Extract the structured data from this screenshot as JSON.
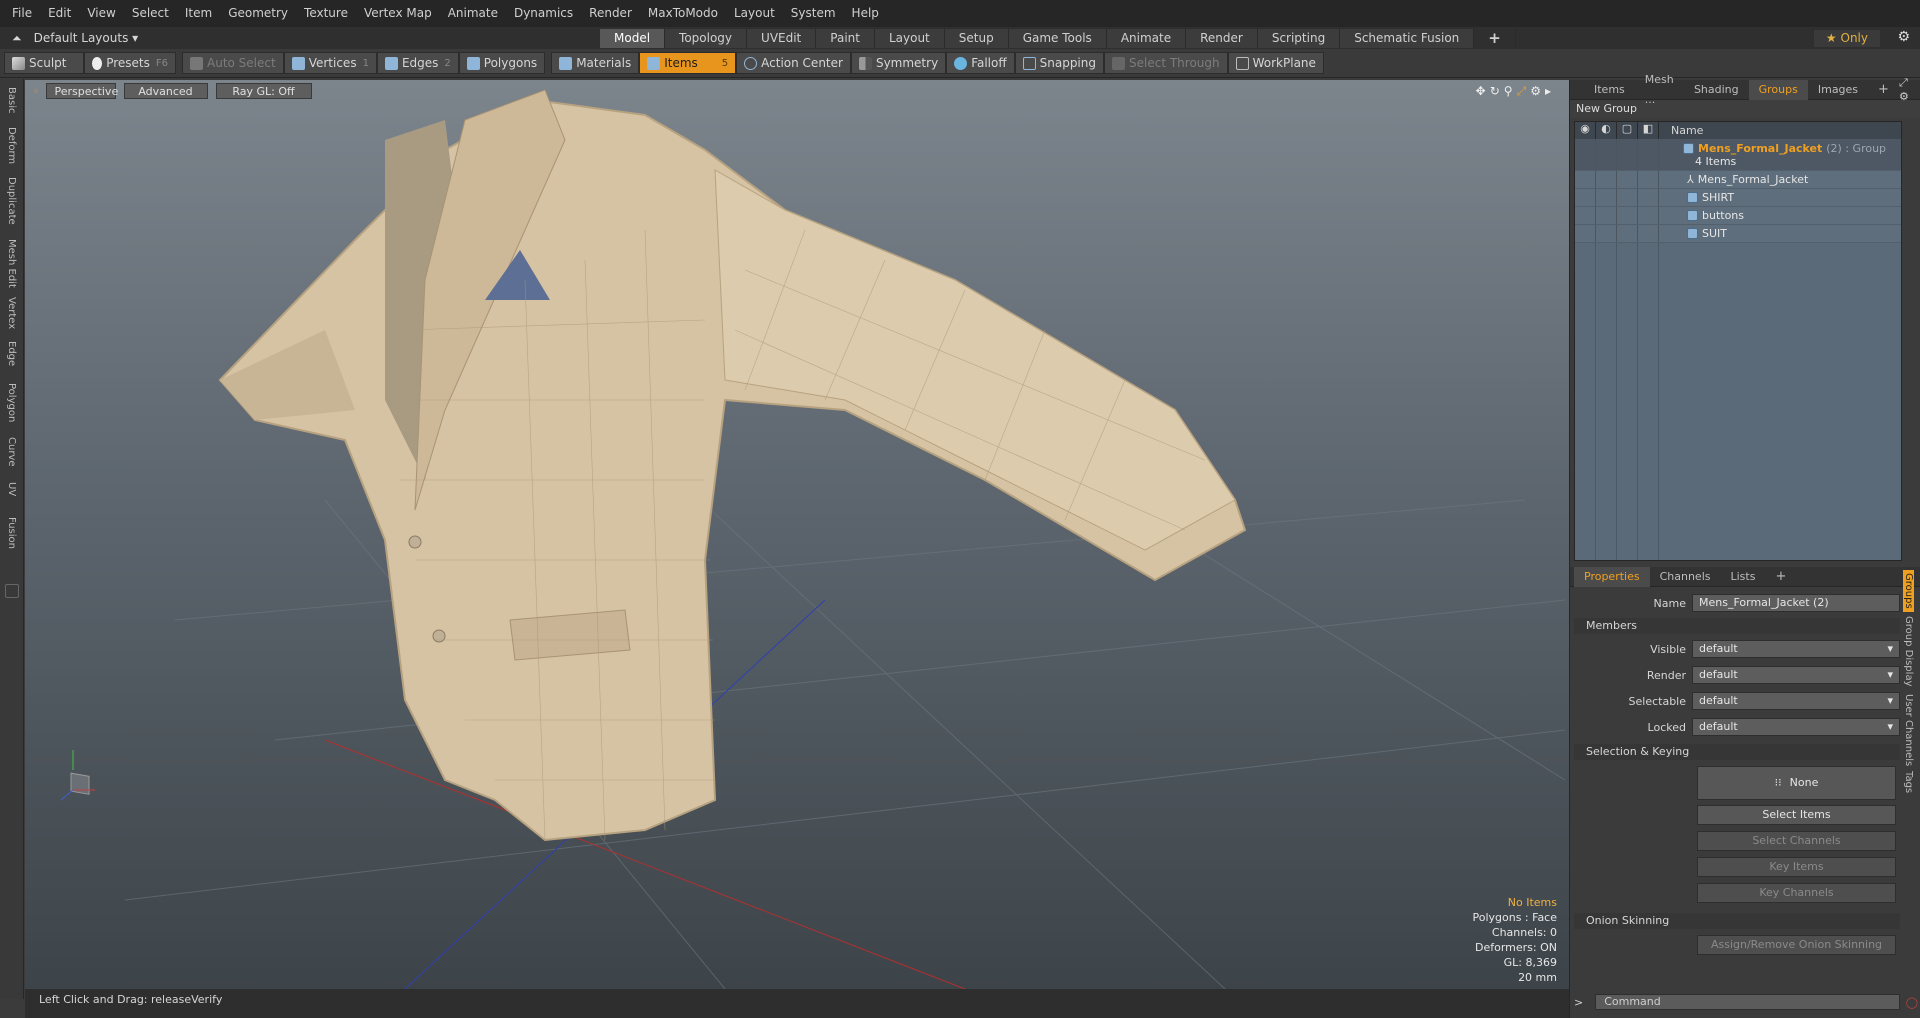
{
  "menubar": [
    "File",
    "Edit",
    "View",
    "Select",
    "Item",
    "Geometry",
    "Texture",
    "Vertex Map",
    "Animate",
    "Dynamics",
    "Render",
    "MaxToModo",
    "Layout",
    "System",
    "Help"
  ],
  "layouts_label": "Default Layouts",
  "layout_tabs": [
    "Model",
    "Topology",
    "UVEdit",
    "Paint",
    "Layout",
    "Setup",
    "Game Tools",
    "Animate",
    "Render",
    "Scripting",
    "Schematic Fusion",
    "+"
  ],
  "only_label": "Only",
  "toolbar": {
    "sculpt": "Sculpt",
    "presets": "Presets",
    "presets_key": "F6",
    "auto_select": "Auto Select",
    "vertices": "Vertices",
    "vertices_num": "1",
    "edges": "Edges",
    "edges_num": "2",
    "polygons": "Polygons",
    "materials": "Materials",
    "items": "Items",
    "items_num": "5",
    "action_center": "Action Center",
    "symmetry": "Symmetry",
    "falloff": "Falloff",
    "snapping": "Snapping",
    "select_through": "Select Through",
    "workplane": "WorkPlane"
  },
  "left_tabs": [
    "Basic",
    "Deform",
    "Duplicate",
    "Mesh Edit",
    "Vertex",
    "Edge",
    "Polygon",
    "Curve",
    "UV",
    "Fusion"
  ],
  "viewport": {
    "perspective": "Perspective",
    "advanced": "Advanced",
    "raygl": "Ray GL: Off",
    "info": {
      "no_items": "No Items",
      "polygons": "Polygons : Face",
      "channels": "Channels: 0",
      "deformers": "Deformers: ON",
      "gl": "GL: 8,369",
      "scale": "20 mm"
    }
  },
  "status": "Left Click and Drag:  releaseVerify",
  "top_panel_tabs": [
    "Items",
    "Mesh ...",
    "Shading",
    "Groups",
    "Images",
    "+"
  ],
  "new_group": "New Group",
  "tree": {
    "name_header": "Name",
    "group_name": "Mens_Formal_Jacket",
    "group_suffix": "(2) : Group",
    "items_count": "4 Items",
    "children": [
      "Mens_Formal_Jacket",
      "SHIRT",
      "buttons",
      "SUIT"
    ]
  },
  "props_tabs": [
    "Properties",
    "Channels",
    "Lists",
    "+"
  ],
  "props": {
    "name_label": "Name",
    "name_value": "Mens_Formal_Jacket (2)",
    "members": "Members",
    "visible_label": "Visible",
    "render_label": "Render",
    "selectable_label": "Selectable",
    "locked_label": "Locked",
    "default": "default",
    "sel_keying": "Selection & Keying",
    "none": "None",
    "select_items": "Select Items",
    "select_channels": "Select Channels",
    "key_items": "Key Items",
    "key_channels": "Key Channels",
    "onion": "Onion Skinning",
    "assign_onion": "Assign/Remove Onion Skinning"
  },
  "side_tabs": [
    "Groups",
    "Group Display",
    "User Channels",
    "Tags"
  ],
  "command_placeholder": "Command",
  "colors": {
    "accent": "#f0a020",
    "highlight": "#e8951e"
  }
}
